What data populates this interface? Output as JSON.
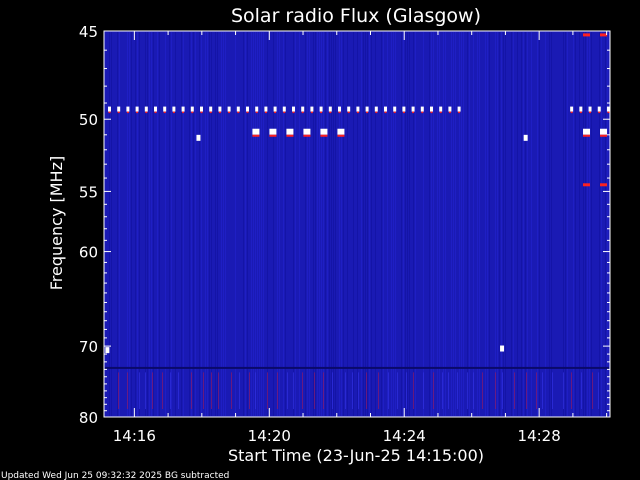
{
  "chart_data": {
    "type": "heatmap",
    "title": "Solar radio Flux (Glasgow)",
    "xlabel": "Start Time (23-Jun-25 14:15:00)",
    "ylabel": "Frequency [MHz]",
    "x_ticks": [
      "14:16",
      "14:20",
      "14:24",
      "14:28"
    ],
    "x_tick_minutes": [
      16,
      20,
      24,
      28
    ],
    "xlim_minutes": [
      15.1,
      30.1
    ],
    "y_ticks": [
      45,
      50,
      55,
      60,
      70,
      80
    ],
    "ylim": [
      80,
      45
    ],
    "y_scale": "reciprocal",
    "colormap": [
      "#000080",
      "#1414c8",
      "#ff2020",
      "#ffffff"
    ],
    "background_color": "#1a1ab4",
    "interference_lines": [
      {
        "freq": 49.4,
        "t_start": 15.1,
        "t_end": 25.8,
        "intensity": "high",
        "style": "dashed"
      },
      {
        "freq": 49.4,
        "t_start": 28.8,
        "t_end": 30.1,
        "intensity": "high",
        "style": "dashed"
      },
      {
        "freq": 50.8,
        "t_start": 19.5,
        "t_end": 22.2,
        "intensity": "high",
        "style": "blocks"
      },
      {
        "freq": 50.8,
        "t_start": 29.3,
        "t_end": 30.0,
        "intensity": "high",
        "style": "blocks"
      },
      {
        "freq": 54.5,
        "t_start": 29.3,
        "t_end": 30.0,
        "intensity": "medium",
        "style": "blocks"
      },
      {
        "freq": 45.2,
        "t_start": 29.3,
        "t_end": 30.0,
        "intensity": "medium",
        "style": "blocks"
      },
      {
        "freq": 72.8,
        "t_start": 15.1,
        "t_end": 30.1,
        "intensity": "low",
        "style": "solid"
      }
    ],
    "isolated_points": [
      {
        "freq": 51.2,
        "t": 17.9
      },
      {
        "freq": 51.2,
        "t": 27.6
      },
      {
        "freq": 70.5,
        "t": 15.2
      },
      {
        "freq": 70.3,
        "t": 26.9
      }
    ]
  },
  "footer": "Updated Wed Jun 25 09:32:32 2025   BG subtracted"
}
